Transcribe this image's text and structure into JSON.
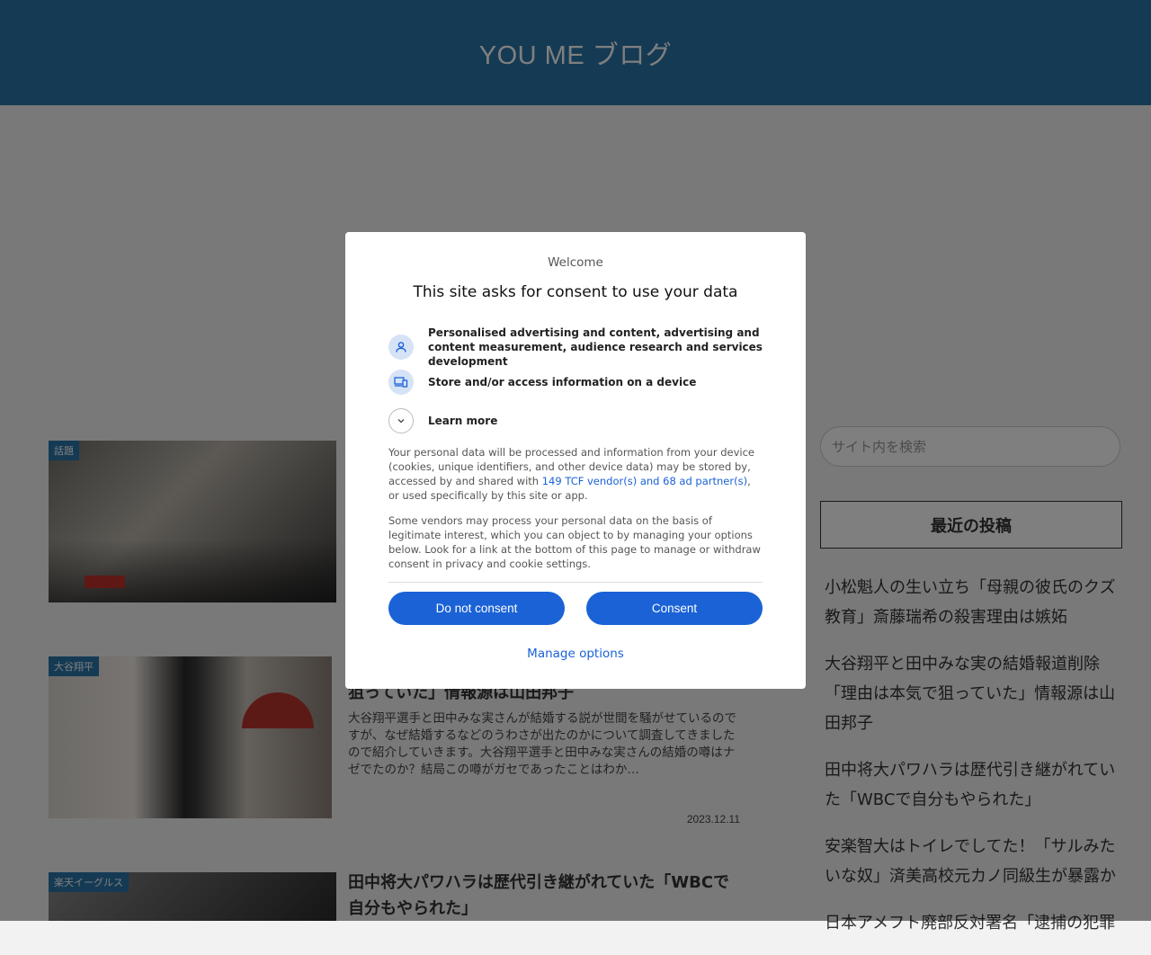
{
  "site": {
    "title": "YOU ME ブログ"
  },
  "posts": [
    {
      "category": "話題",
      "title": "",
      "excerpt": "",
      "date": ""
    },
    {
      "category": "大谷翔平",
      "title": "狙っていた」情報源は山田邦子",
      "excerpt": "大谷翔平選手と田中みな実さんが結婚する説が世間を騒がせているのですが、なぜ結婚するなどのうわさが出たのかについて調査してきましたので紹介していきます。大谷翔平選手と田中みな実さんの結婚の噂はナゼでたのか？結局この噂がガセであったことはわか…",
      "date": "2023.12.11"
    },
    {
      "category": "楽天イーグルス",
      "title": "田中将大パワハラは歴代引き継がれていた「WBCで自分もやられた」",
      "excerpt": "",
      "date": ""
    }
  ],
  "sidebar": {
    "search_placeholder": "サイト内を検索",
    "recent_title": "最近の投稿",
    "recent": [
      "小松魁人の生い立ち「母親の彼氏のクズ教育」斎藤瑞希の殺害理由は嫉妬",
      "大谷翔平と田中みな実の結婚報道削除「理由は本気で狙っていた」情報源は山田邦子",
      "田中将大パワハラは歴代引き継がれていた「WBCで自分もやられた」",
      "安楽智大はトイレでしてた！「サルみたいな奴」済美高校元カノ同級生が暴露か",
      "日本アメフト廃部反対署名「逮捕の犯罪"
    ]
  },
  "consent": {
    "welcome": "Welcome",
    "heading": "This site asks for consent to use your data",
    "purposes": [
      {
        "icon": "person-icon",
        "text": "Personalised advertising and content, advertising and content measurement, audience research and services development"
      },
      {
        "icon": "devices-icon",
        "text": "Store and/or access information on a device"
      },
      {
        "icon": "chevron-down-icon",
        "text": "Learn more"
      }
    ],
    "para1_before": "Your personal data will be processed and information from your device (cookies, unique identifiers, and other device data) may be stored by, accessed by and shared with ",
    "para1_link": "149 TCF vendor(s) and 68 ad partner(s)",
    "para1_after": ", or used specifically by this site or app.",
    "para2": "Some vendors may process your personal data on the basis of legitimate interest, which you can object to by managing your options below. Look for a link at the bottom of this page to manage or withdraw consent in privacy and cookie settings.",
    "do_not_consent": "Do not consent",
    "consent": "Consent",
    "manage": "Manage options"
  }
}
